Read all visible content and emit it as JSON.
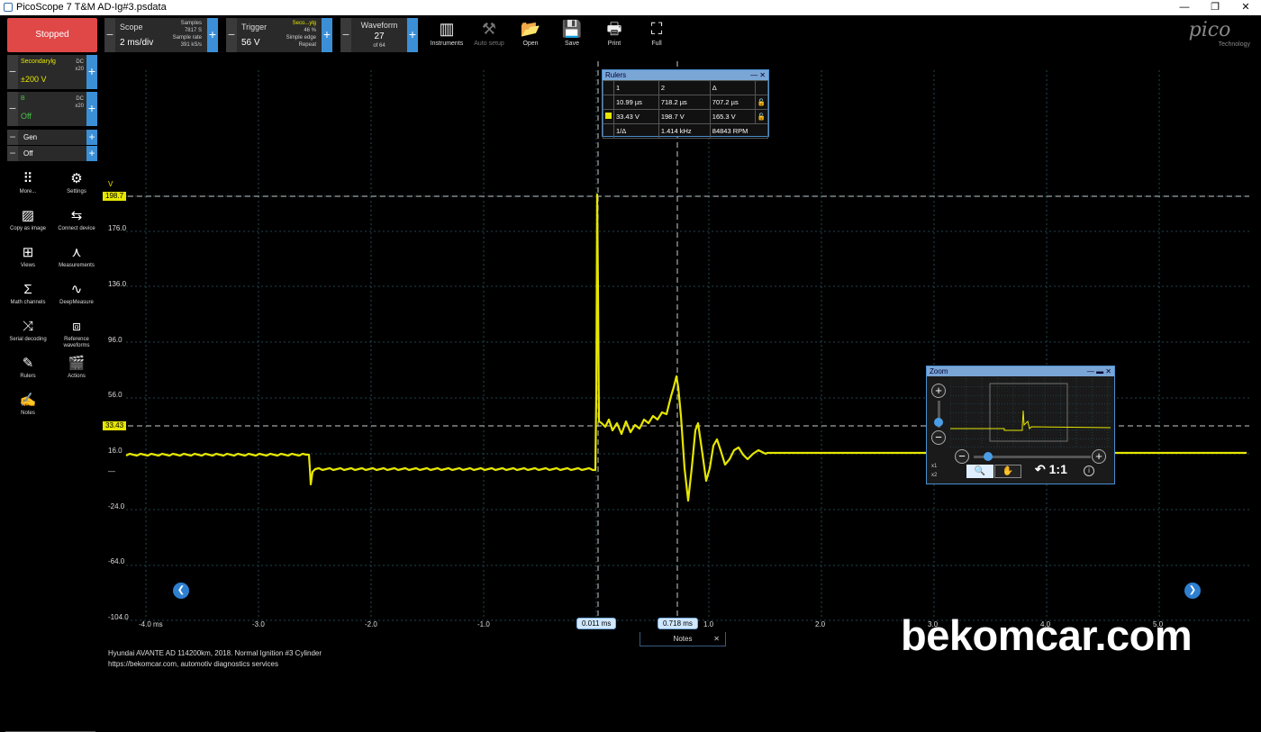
{
  "window": {
    "title": "PicoScope 7 T&M AD-Ig#3.psdata",
    "minimize": "—",
    "restore": "❐",
    "close": "✕"
  },
  "toolbar": {
    "stopped_label": "Stopped",
    "scope": {
      "label": "Scope",
      "timebase": "2 ms/div",
      "samples_label": "Samples",
      "samples": "7817 S",
      "sample_rate_label": "Sample rate",
      "sample_rate": "391 kS/s"
    },
    "trigger": {
      "label": "Trigger",
      "level": "56 V",
      "source": "Seco...ylg",
      "percent": "46 %",
      "type": "Simple edge",
      "mode": "Repeat"
    },
    "waveform": {
      "label": "Waveform",
      "current": "27",
      "of": "of 64"
    },
    "tools": [
      {
        "label": "Instruments",
        "icon": "instruments-icon"
      },
      {
        "label": "Auto setup",
        "icon": "auto-setup-icon"
      },
      {
        "label": "Open",
        "icon": "folder-icon"
      },
      {
        "label": "Save",
        "icon": "save-icon"
      },
      {
        "label": "Print",
        "icon": "print-icon"
      },
      {
        "label": "Full",
        "icon": "fullscreen-icon"
      }
    ],
    "logo": "pico",
    "logo_sub": "Technology"
  },
  "channels": {
    "a": {
      "name": "Secondarylg",
      "range": "±200 V",
      "coupling": "DC",
      "probe": "x20"
    },
    "b": {
      "name": "B",
      "range": "Off",
      "coupling": "DC",
      "probe": "x20"
    },
    "gen": {
      "name": "Gen",
      "state": "Off"
    }
  },
  "sidebar": [
    {
      "label": "More...",
      "icon": "grid-icon"
    },
    {
      "label": "Settings",
      "icon": "gear-icon"
    },
    {
      "label": "Copy as image",
      "icon": "image-icon"
    },
    {
      "label": "Connect device",
      "icon": "usb-icon"
    },
    {
      "label": "Views",
      "icon": "views-icon"
    },
    {
      "label": "Measurements",
      "icon": "measurements-icon"
    },
    {
      "label": "Math channels",
      "icon": "sigma-icon"
    },
    {
      "label": "DeepMeasure",
      "icon": "deepmeasure-icon"
    },
    {
      "label": "Serial decoding",
      "icon": "serial-icon"
    },
    {
      "label": "Reference waveforms",
      "icon": "reference-icon"
    },
    {
      "label": "Rulers",
      "icon": "ruler-icon"
    },
    {
      "label": "Actions",
      "icon": "clapper-icon"
    },
    {
      "label": "Notes",
      "icon": "notes-icon"
    }
  ],
  "scope": {
    "y_unit": "V",
    "y_ticks": [
      "176.0",
      "136.0",
      "96.0",
      "56.0",
      "16.0",
      "—",
      "-24.0",
      "-64.0",
      "-104.0"
    ],
    "x_ticks": [
      "-4.0 ms",
      "-3.0",
      "-2.0",
      "-1.0",
      "1.0",
      "2.0",
      "3.0",
      "4.0",
      "5.0"
    ],
    "y_marker_top": "198.7",
    "y_marker_mid": "33.43",
    "cursor_1": "0.011 ms",
    "cursor_2": "0.718 ms",
    "trace_color": "#e6e600"
  },
  "rulers": {
    "title": "Rulers",
    "col1": "1",
    "col2": "2",
    "col_delta": "Δ",
    "row_time": [
      "10.99 µs",
      "718.2 µs",
      "707.2 µs"
    ],
    "row_volt": [
      "33.43 V",
      "198.7 V",
      "165.3 V"
    ],
    "inv_label": "1/Δ",
    "freq": "1.414 kHz",
    "rpm": "84843 RPM"
  },
  "zoom": {
    "title": "Zoom",
    "reset": "1:1",
    "x1": "x1",
    "x2": "x2"
  },
  "notes": {
    "tab": "Notes",
    "line1": "Hyundai AVANTE AD 114200km, 2018. Normal Ignition #3 Cylinder",
    "line2": "https://bekomcar.com, automotiv diagnostics services"
  },
  "watermark": "bekomcar.com"
}
